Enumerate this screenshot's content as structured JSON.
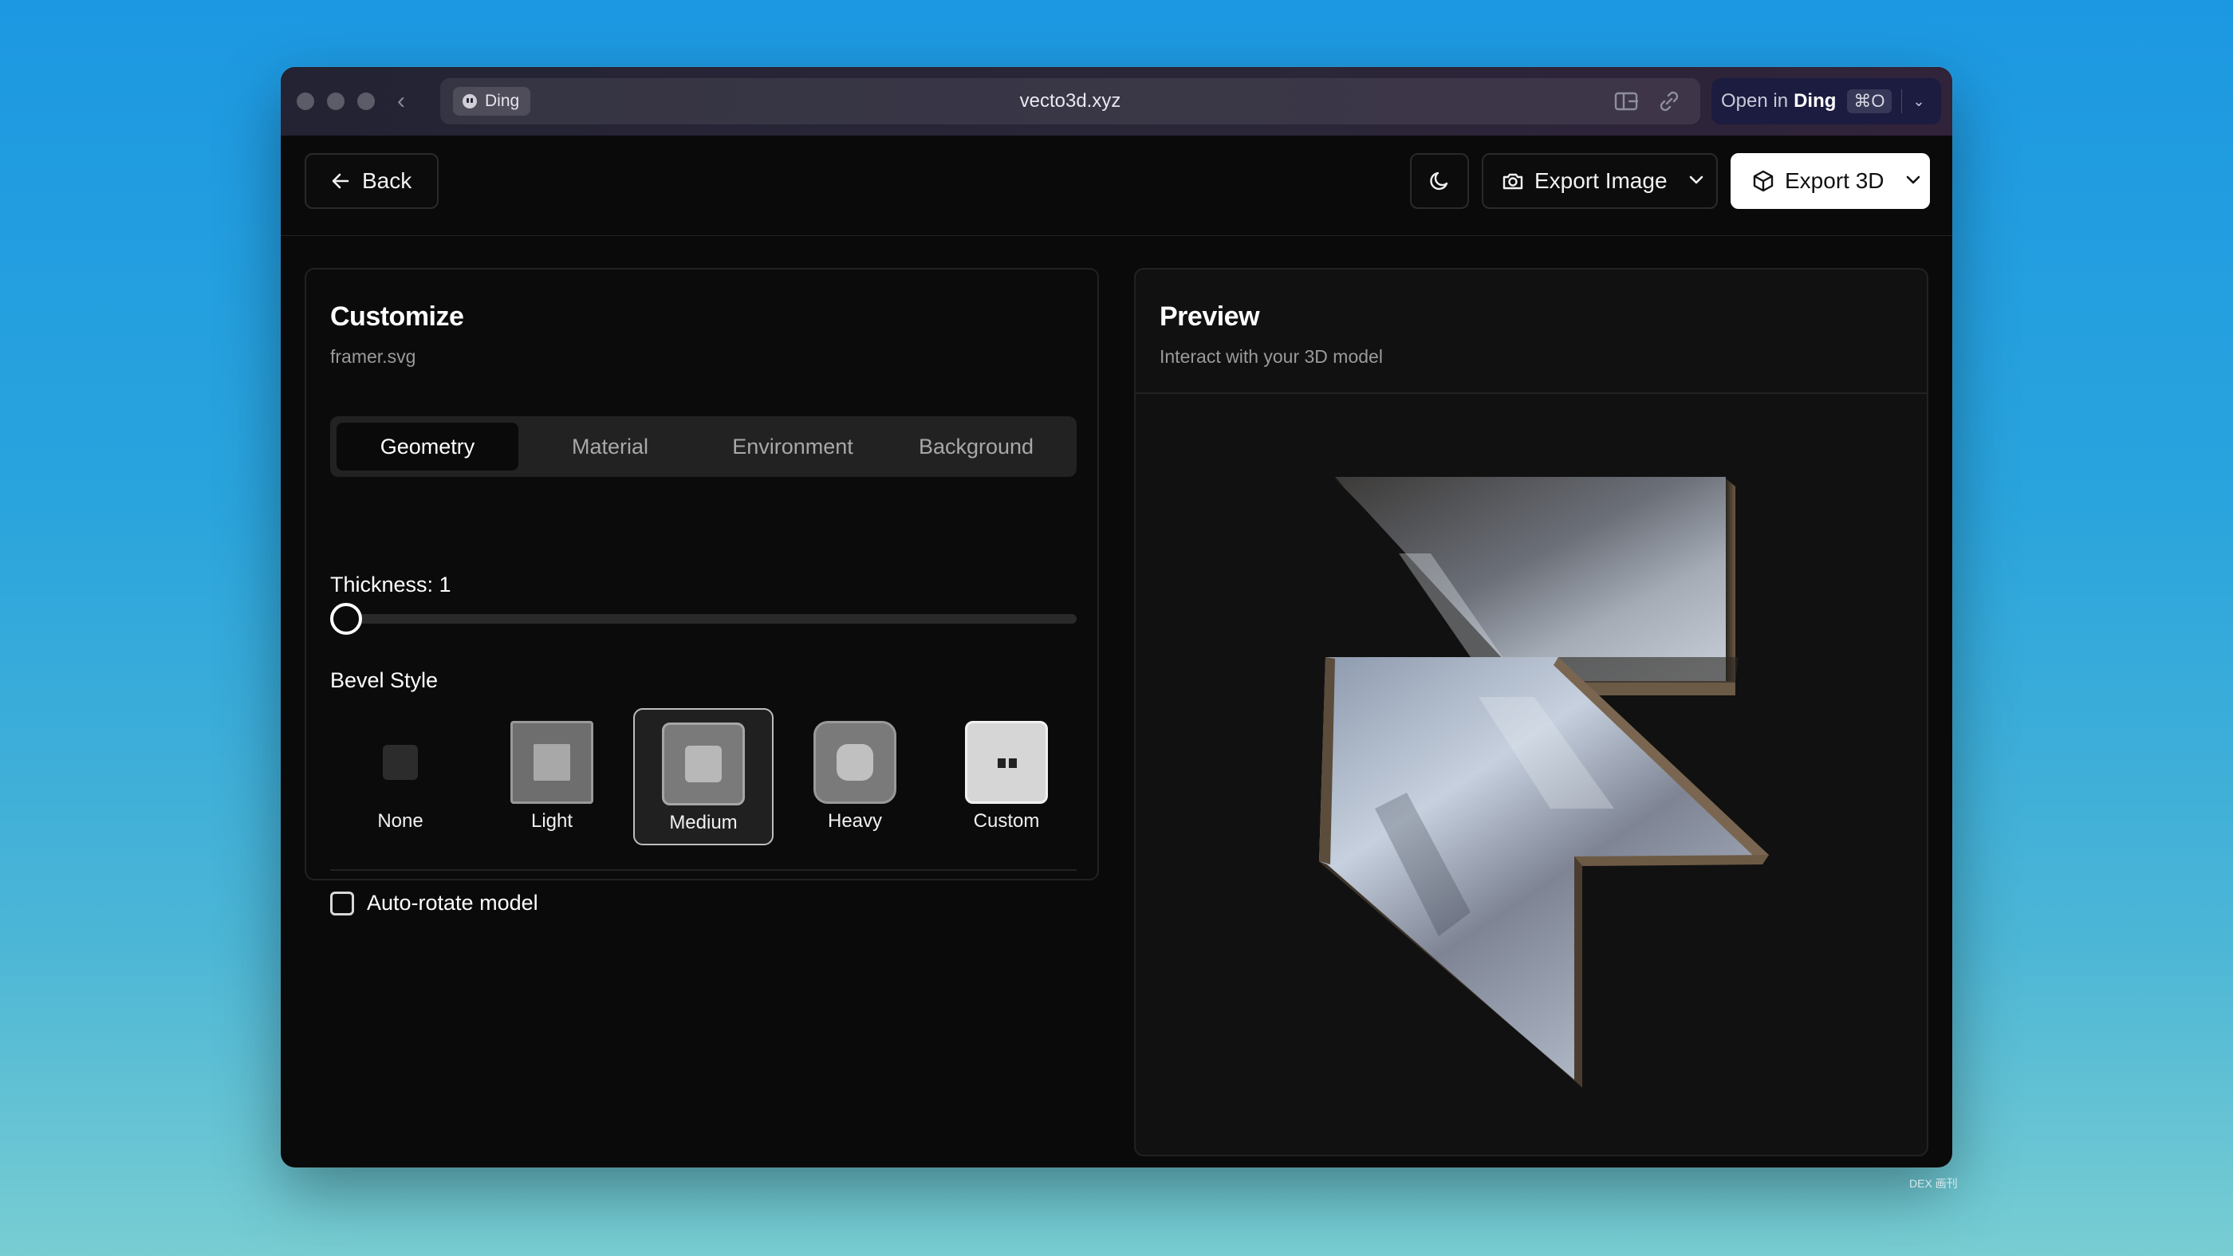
{
  "browser": {
    "site_name": "Ding",
    "url": "vecto3d.xyz",
    "open_in_prefix": "Open in",
    "open_in_app": "Ding",
    "open_in_shortcut": "⌘O"
  },
  "header": {
    "back_label": "Back",
    "export_image_label": "Export Image",
    "export_3d_label": "Export 3D"
  },
  "customize": {
    "title": "Customize",
    "filename": "framer.svg",
    "tabs": [
      {
        "label": "Geometry",
        "active": true
      },
      {
        "label": "Material",
        "active": false
      },
      {
        "label": "Environment",
        "active": false
      },
      {
        "label": "Background",
        "active": false
      }
    ],
    "thickness_label": "Thickness: 1",
    "thickness_value": 1,
    "bevel_label": "Bevel Style",
    "bevel_options": [
      {
        "label": "None"
      },
      {
        "label": "Light"
      },
      {
        "label": "Medium",
        "selected": true
      },
      {
        "label": "Heavy"
      },
      {
        "label": "Custom"
      }
    ],
    "auto_rotate_label": "Auto-rotate model",
    "auto_rotate_checked": false
  },
  "preview": {
    "title": "Preview",
    "subtitle": "Interact with your 3D model"
  },
  "watermark": "DEX 画刊",
  "colors": {
    "app_bg": "#0a0a0a",
    "panel_border": "#222222",
    "primary_button_bg": "#ffffff",
    "open_in_bg": "#1c1c40"
  }
}
